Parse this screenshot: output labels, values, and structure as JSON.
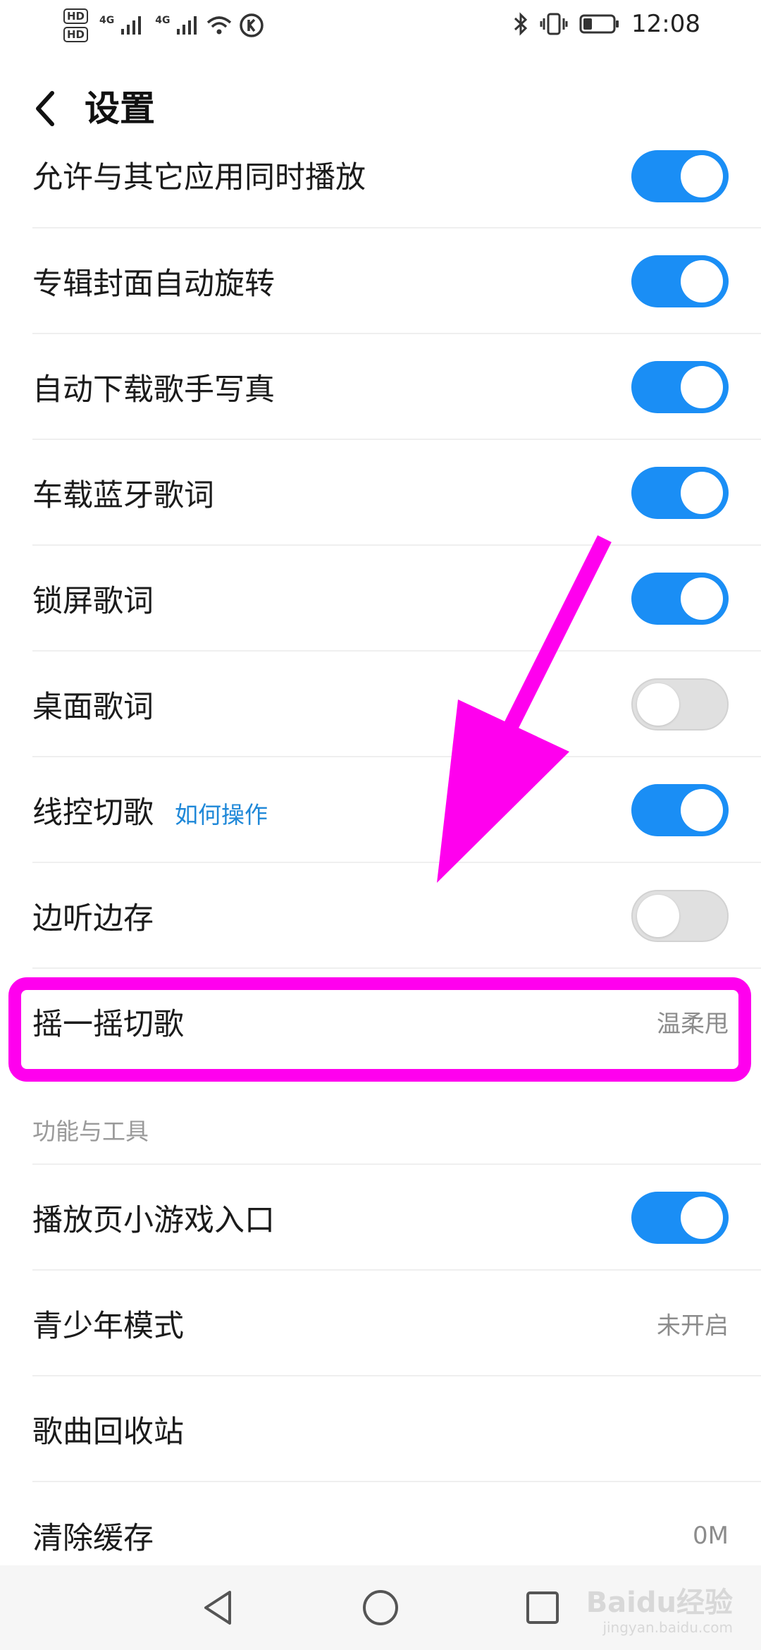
{
  "status_bar": {
    "hd1": "HD",
    "hd2": "HD",
    "net1": "4G",
    "net2": "4G",
    "time": "12:08"
  },
  "header": {
    "title": "设置"
  },
  "settings": [
    {
      "label": "允许与其它应用同时播放",
      "toggle": "on"
    },
    {
      "label": "专辑封面自动旋转",
      "toggle": "on"
    },
    {
      "label": "自动下载歌手写真",
      "toggle": "on"
    },
    {
      "label": "车载蓝牙歌词",
      "toggle": "on"
    },
    {
      "label": "锁屏歌词",
      "toggle": "on"
    },
    {
      "label": "桌面歌词",
      "toggle": "off"
    },
    {
      "label": "线控切歌",
      "hint": "如何操作",
      "toggle": "on"
    },
    {
      "label": "边听边存",
      "toggle": "off"
    },
    {
      "label": "摇一摇切歌",
      "value": "温柔甩"
    }
  ],
  "section": {
    "title": "功能与工具"
  },
  "tools": [
    {
      "label": "播放页小游戏入口",
      "toggle": "on"
    },
    {
      "label": "青少年模式",
      "value": "未开启"
    },
    {
      "label": "歌曲回收站"
    },
    {
      "label": "清除缓存",
      "value": "0M"
    }
  ],
  "watermark": {
    "brand": "Baidu经验",
    "url": "jingyan.baidu.com"
  },
  "colors": {
    "toggle_on": "#1a8ef5",
    "toggle_off": "#e0e0e0",
    "annotation": "#ff00ee",
    "hint": "#1f88d8"
  }
}
